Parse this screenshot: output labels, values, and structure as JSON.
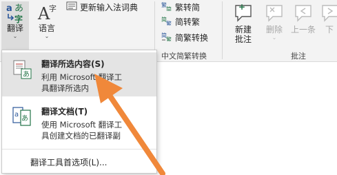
{
  "ribbon": {
    "translate_label": "翻译",
    "language_label": "语言",
    "update_ime_label": "更新输入法词典",
    "trad_to_simp_label": "繁转简",
    "simp_to_trad_label": "简转繁",
    "convert_label": "简繁转换",
    "chinese_conversion_group": "中文简繁转换",
    "new_comment_label": "新建\n批注",
    "delete_label": "删除",
    "prev_label": "上一条",
    "next_label": "下",
    "comments_group": "批注"
  },
  "menu": {
    "items": [
      {
        "title": "翻译所选内容(S)",
        "desc_line1": "利用 Microsoft 翻译工",
        "desc_line2": "具翻译所选内"
      },
      {
        "title": "翻译文档(T)",
        "desc_line1": "使用 Microsoft 翻译工",
        "desc_line2": "具创建文档的已翻译副"
      }
    ],
    "options_label": "翻译工具首选项(L)..."
  },
  "colors": {
    "ribbon_bg": "#f3f3f3",
    "hover_bg": "#e4e4e4",
    "accent_blue": "#2b579a",
    "accent_green": "#217346",
    "arrow": "#f0883a"
  },
  "icons": [
    "translate-icon",
    "language-icon",
    "update-dictionary-icon",
    "traditional-to-simplified-icon",
    "simplified-to-traditional-icon",
    "chinese-conversion-icon",
    "new-comment-icon",
    "delete-comment-icon",
    "previous-comment-icon",
    "next-comment-icon",
    "translate-selection-icon",
    "translate-document-icon",
    "pointer-arrow"
  ]
}
